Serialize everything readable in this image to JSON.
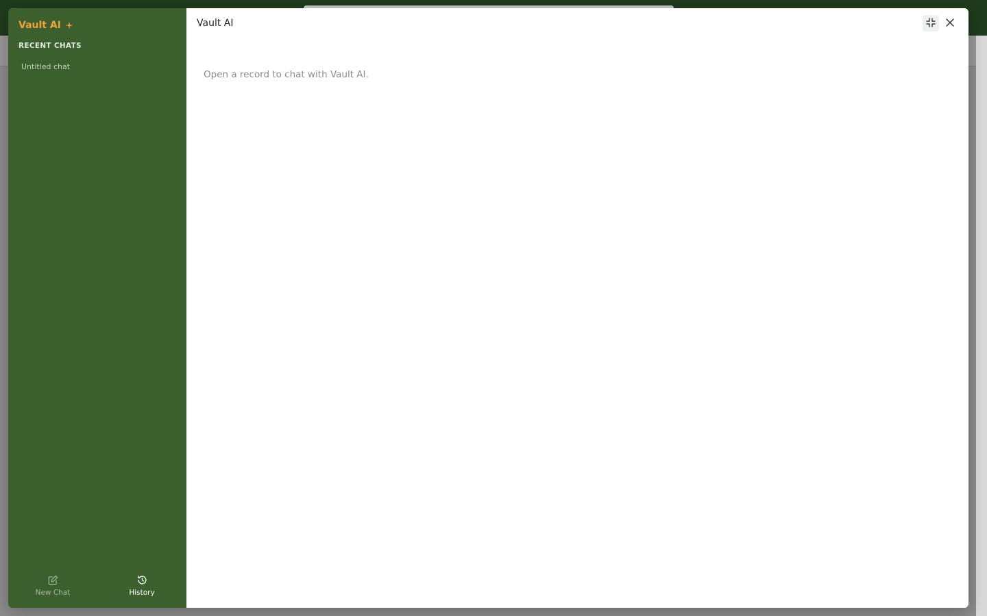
{
  "sidebar": {
    "brand": "Vault AI",
    "brand_icon": "sparkle-icon",
    "section_label": "RECENT CHATS",
    "chats": [
      {
        "label": "Untitled chat"
      }
    ],
    "footer": {
      "new_chat_label": "New Chat",
      "new_chat_icon": "edit-icon",
      "history_label": "History",
      "history_icon": "history-icon",
      "active_tab": "History"
    }
  },
  "main": {
    "title": "Vault AI",
    "empty_message": "Open a record to chat with Vault AI.",
    "controls": {
      "minimize_icon": "minimize-icon",
      "close_icon": "close-icon"
    }
  },
  "colors": {
    "sidebar_bg": "#3b602e",
    "brand_accent": "#f0a23a",
    "topbar_bg": "#1f3a1c",
    "main_bg": "#ffffff"
  }
}
